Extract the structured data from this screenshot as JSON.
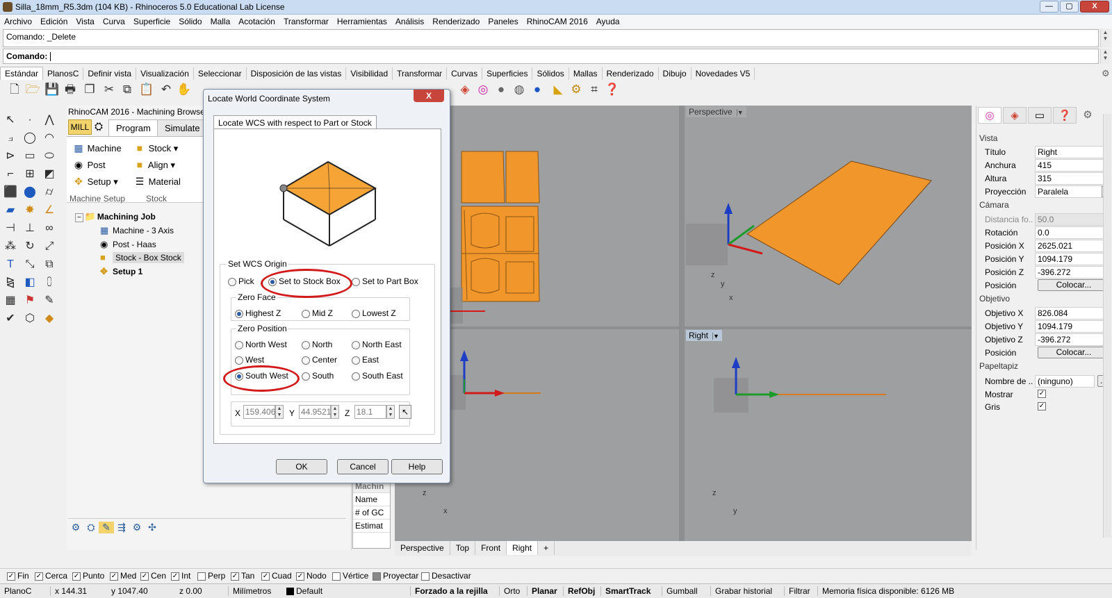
{
  "window": {
    "title": "Silla_18mm_R5.3dm (104 KB) - Rhinoceros 5.0 Educational Lab License",
    "min_label": "—",
    "max_label": "▢",
    "close_label": "X"
  },
  "menu": [
    "Archivo",
    "Edición",
    "Vista",
    "Curva",
    "Superficie",
    "Sólido",
    "Malla",
    "Acotación",
    "Transformar",
    "Herramientas",
    "Análisis",
    "Renderizado",
    "Paneles",
    "RhinoCAM 2016",
    "Ayuda"
  ],
  "command": {
    "history": "Comando: _Delete",
    "prompt": "Comando:"
  },
  "toolbar_tabs": [
    "Estándar",
    "PlanosC",
    "Definir vista",
    "Visualización",
    "Seleccionar",
    "Disposición de las vistas",
    "Visibilidad",
    "Transformar",
    "Curvas",
    "Superficies",
    "Sólidos",
    "Mallas",
    "Renderizado",
    "Dibujo",
    "Novedades V5"
  ],
  "rhinocam": {
    "title": "RhinoCAM 2016 - Machining Browser",
    "mill_label": "MILL",
    "tabs": [
      "Program",
      "Simulate"
    ],
    "ribbon": {
      "machine": "Machine",
      "post": "Post",
      "setup": "Setup",
      "stock": "Stock",
      "align": "Align",
      "material": "Material",
      "group_machine_setup": "Machine Setup",
      "group_stock": "Stock"
    },
    "tree": {
      "root": "Machining Job",
      "machine": "Machine - 3 Axis",
      "post": "Post - Haas",
      "stock": "Stock - Box Stock",
      "setup": "Setup 1"
    },
    "props": {
      "header": "Machin",
      "name": "Name",
      "count": "# of GC",
      "estim": "Estimat"
    }
  },
  "dialog": {
    "title": "Locate World Coordinate System",
    "close_label": "X",
    "tab": "Locate WCS with respect to Part or Stock",
    "origin": {
      "label": "Set WCS Origin",
      "pick": "Pick",
      "stock": "Set to Stock Box",
      "part": "Set to Part Box"
    },
    "zero_face": {
      "label": "Zero Face",
      "highest": "Highest Z",
      "mid": "Mid Z",
      "lowest": "Lowest Z"
    },
    "zero_position": {
      "label": "Zero Position",
      "nw": "North West",
      "n": "North",
      "ne": "North East",
      "w": "West",
      "c": "Center",
      "e": "East",
      "sw": "South West",
      "s": "South",
      "se": "South East"
    },
    "coords": {
      "x_label": "X",
      "y_label": "Y",
      "z_label": "Z",
      "x": "159.406",
      "y": "44.9521",
      "z": "18.1"
    },
    "buttons": {
      "ok": "OK",
      "cancel": "Cancel",
      "help": "Help"
    }
  },
  "viewports": {
    "perspective": "Perspective",
    "right": "Right",
    "axis_x": "x",
    "axis_y": "y",
    "axis_z": "z",
    "tabs": [
      "Perspective",
      "Top",
      "Front",
      "Right"
    ],
    "add_tab": "+"
  },
  "properties": {
    "vista": "Vista",
    "titulo_k": "Título",
    "titulo_v": "Right",
    "anchura_k": "Anchura",
    "anchura_v": "415",
    "altura_k": "Altura",
    "altura_v": "315",
    "proyeccion_k": "Proyección",
    "proyeccion_v": "Paralela",
    "camara": "Cámara",
    "distancia_k": "Distancia fo...",
    "distancia_v": "50.0",
    "rotacion_k": "Rotación",
    "rotacion_v": "0.0",
    "posx_k": "Posición X",
    "posx_v": "2625.021",
    "posy_k": "Posición Y",
    "posy_v": "1094.179",
    "posz_k": "Posición Z",
    "posz_v": "-396.272",
    "posicion_k": "Posición",
    "colocar": "Colocar...",
    "objetivo": "Objetivo",
    "objx_k": "Objetivo X",
    "objx_v": "826.084",
    "objy_k": "Objetivo Y",
    "objy_v": "1094.179",
    "objz_k": "Objetivo Z",
    "objz_v": "-396.272",
    "papeltapiz": "Papeltapiz",
    "nombre_k": "Nombre de ...",
    "nombre_v": "(ninguno)",
    "mostrar_k": "Mostrar",
    "gris_k": "Gris",
    "browse": "..."
  },
  "osnap": {
    "fin": "Fin",
    "cerca": "Cerca",
    "punto": "Punto",
    "med": "Med",
    "cen": "Cen",
    "int": "Int",
    "perp": "Perp",
    "tan": "Tan",
    "cuad": "Cuad",
    "nodo": "Nodo",
    "vertice": "Vértice",
    "proyectar": "Proyectar",
    "desactivar": "Desactivar"
  },
  "status": {
    "plano": "PlanoC",
    "x": "x 144.31",
    "y": "y 1047.40",
    "z": "z 0.00",
    "units": "Milímetros",
    "layer": "Default",
    "grid": "Forzado a la rejilla",
    "orto": "Orto",
    "planar": "Planar",
    "refobj": "RefObj",
    "smarttrack": "SmartTrack",
    "gumball": "Gumball",
    "history": "Grabar historial",
    "filtrar": "Filtrar",
    "memory": "Memoria física disponible: 6126 MB"
  },
  "colors": {
    "orange": "#f0962a",
    "viewport_bg": "#9e9fa1",
    "highlight_red": "#d31a1a",
    "stock_top": "#f6a436"
  }
}
